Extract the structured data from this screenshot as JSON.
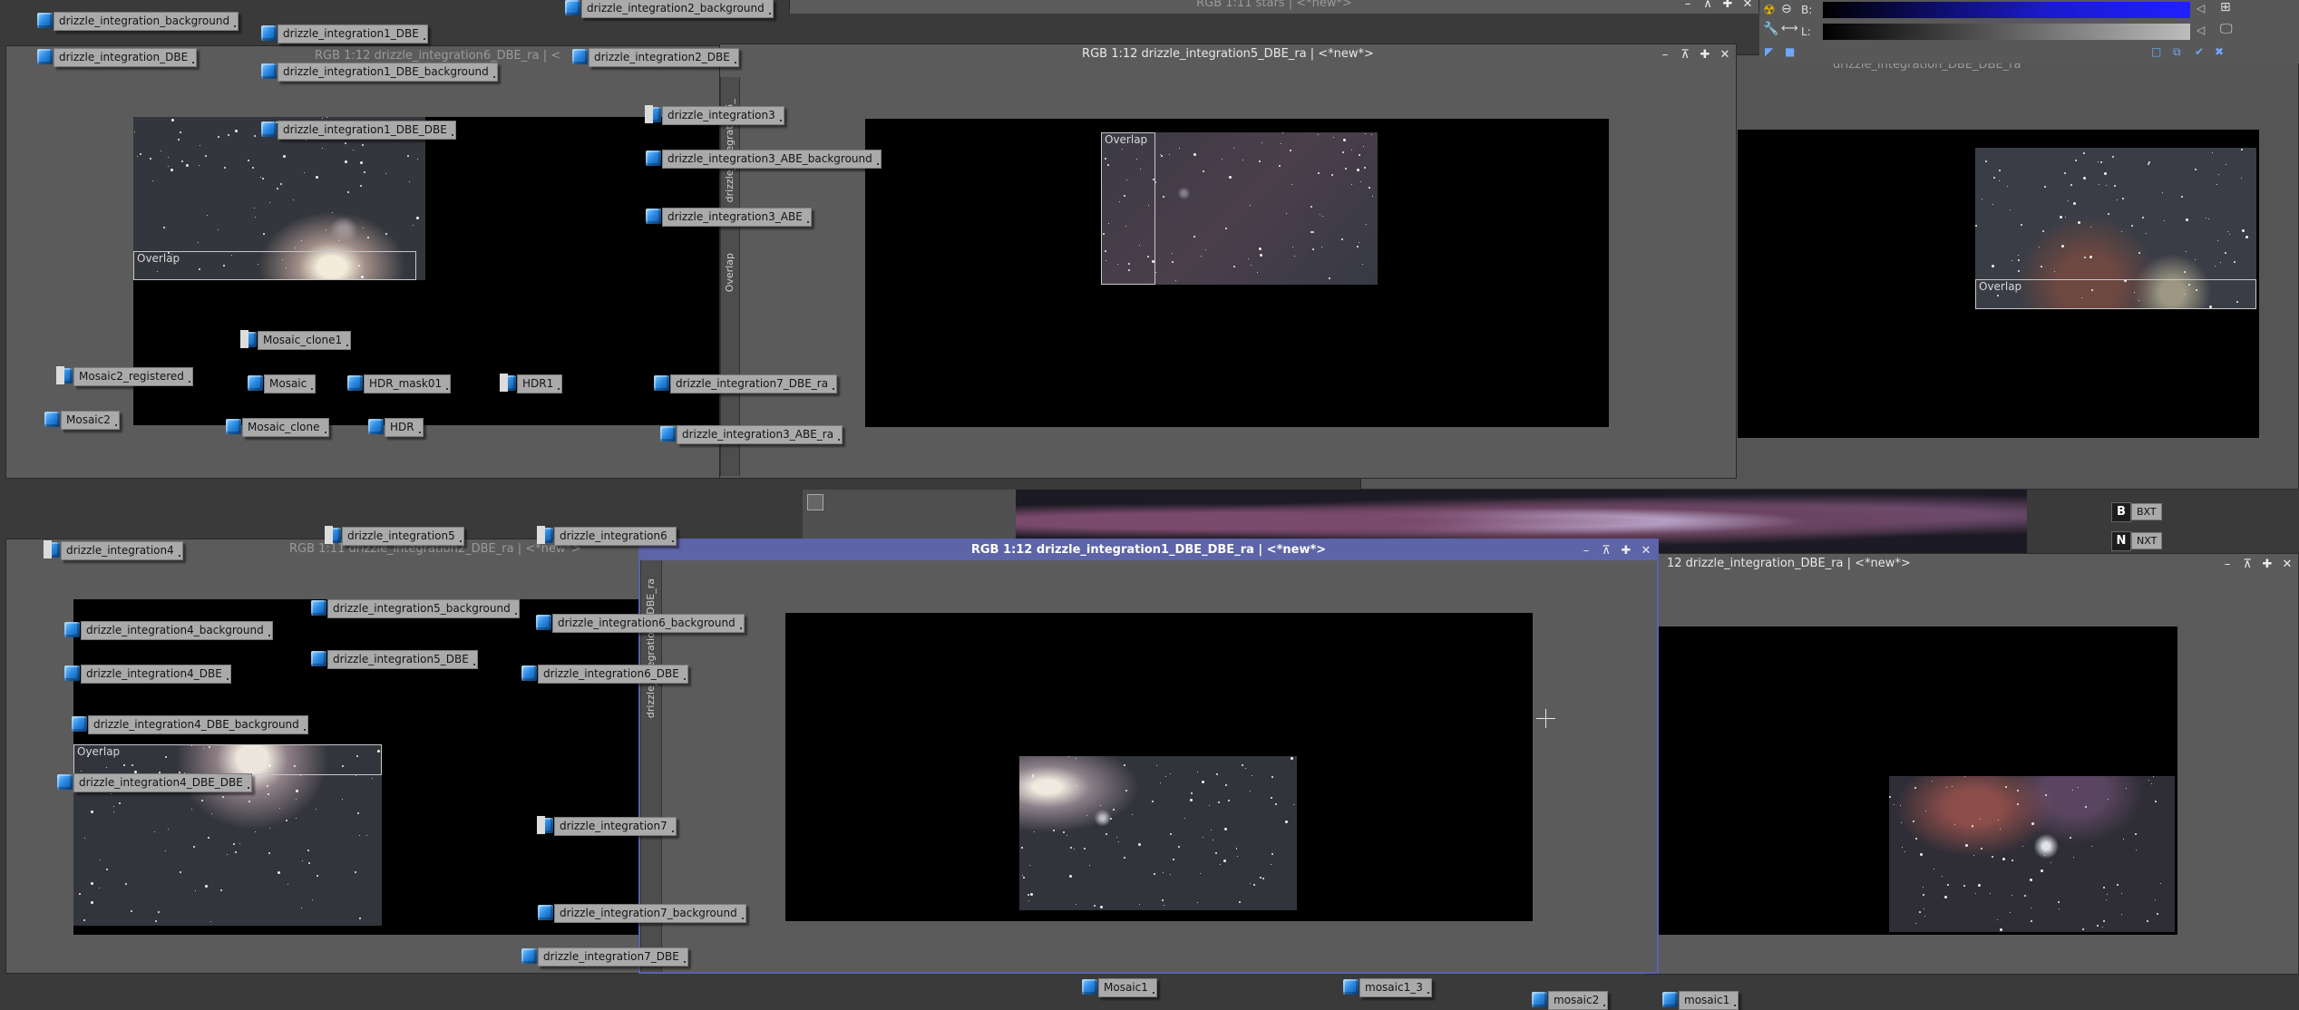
{
  "windows": {
    "w_stars": {
      "title": "RGB 1:11 stars | <*new*>"
    },
    "w_int6": {
      "title": "RGB 1:12 drizzle_integration6_DBE_ra | <"
    },
    "w_int5": {
      "title": "RGB 1:12 drizzle_integration5_DBE_ra | <*new*>"
    },
    "w_right_top": {
      "title": "drizzle_integration_DBE_DBE_ra"
    },
    "w_int2": {
      "title": "RGB 1:11 drizzle_integration2_DBE_ra | <*new*>"
    },
    "w_int1": {
      "title": "RGB 1:12 drizzle_integration1_DBE_DBE_ra | <*new*>"
    },
    "w_right_bottom": {
      "title": "12 drizzle_integration_DBE_ra | <*new*>"
    }
  },
  "overlap_label": "Overlap",
  "histogram": {
    "b_label": "B:",
    "l_label": "L:"
  },
  "icons": [
    {
      "id": "i1",
      "label": "drizzle_integration_background",
      "type": "cube"
    },
    {
      "id": "i2",
      "label": "drizzle_integration_DBE",
      "type": "cube"
    },
    {
      "id": "i3",
      "label": "drizzle_integration1_DBE",
      "type": "cube"
    },
    {
      "id": "i4",
      "label": "drizzle_integration1_DBE_background",
      "type": "cube"
    },
    {
      "id": "i5",
      "label": "drizzle_integration2_background",
      "type": "cube"
    },
    {
      "id": "i6",
      "label": "drizzle_integration2_DBE",
      "type": "cube"
    },
    {
      "id": "i7",
      "label": "drizzle_integration1_DBE_DBE",
      "type": "cube"
    },
    {
      "id": "i8",
      "label": "drizzle_integration3",
      "type": "xisf"
    },
    {
      "id": "i9",
      "label": "drizzle_integration3_ABE_background",
      "type": "cube"
    },
    {
      "id": "i10",
      "label": "drizzle_integration3_ABE",
      "type": "cube"
    },
    {
      "id": "i11",
      "label": "Mosaic_clone1",
      "type": "xisf"
    },
    {
      "id": "i12",
      "label": "Mosaic2_registered",
      "type": "xisf"
    },
    {
      "id": "i13",
      "label": "Mosaic",
      "type": "cube"
    },
    {
      "id": "i14",
      "label": "HDR_mask01",
      "type": "cube"
    },
    {
      "id": "i15",
      "label": "HDR1",
      "type": "xisf"
    },
    {
      "id": "i16",
      "label": "drizzle_integration7_DBE_ra",
      "type": "cube"
    },
    {
      "id": "i17",
      "label": "Mosaic2",
      "type": "cube"
    },
    {
      "id": "i18",
      "label": "Mosaic_clone",
      "type": "cube"
    },
    {
      "id": "i19",
      "label": "HDR",
      "type": "cube"
    },
    {
      "id": "i20",
      "label": "drizzle_integration3_ABE_ra",
      "type": "cube"
    },
    {
      "id": "i21",
      "label": "drizzle_integration5",
      "type": "xisf"
    },
    {
      "id": "i22",
      "label": "drizzle_integration6",
      "type": "xisf"
    },
    {
      "id": "i23",
      "label": "drizzle_integration4",
      "type": "xisf"
    },
    {
      "id": "i24",
      "label": "drizzle_integration5_background",
      "type": "cube"
    },
    {
      "id": "i25",
      "label": "drizzle_integration4_background",
      "type": "cube"
    },
    {
      "id": "i26",
      "label": "drizzle_integration6_background",
      "type": "cube"
    },
    {
      "id": "i27",
      "label": "drizzle_integration5_DBE",
      "type": "cube"
    },
    {
      "id": "i28",
      "label": "drizzle_integration4_DBE",
      "type": "cube"
    },
    {
      "id": "i29",
      "label": "drizzle_integration6_DBE",
      "type": "cube"
    },
    {
      "id": "i30",
      "label": "drizzle_integration4_DBE_background",
      "type": "cube"
    },
    {
      "id": "i31",
      "label": "drizzle_integration4_DBE_DBE",
      "type": "cube"
    },
    {
      "id": "i32",
      "label": "drizzle_integration7",
      "type": "xisf"
    },
    {
      "id": "i33",
      "label": "drizzle_integration7_background",
      "type": "cube"
    },
    {
      "id": "i34",
      "label": "drizzle_integration7_DBE",
      "type": "cube"
    },
    {
      "id": "i35",
      "label": "Mosaic1",
      "type": "cube"
    },
    {
      "id": "i36",
      "label": "mosaic1_3",
      "type": "cube"
    },
    {
      "id": "i37",
      "label": "mosaic2",
      "type": "cube"
    },
    {
      "id": "i38",
      "label": "mosaic1",
      "type": "cube"
    }
  ],
  "strip_labels": {
    "s1": "Overlap",
    "s2": "drizzle_integration5_",
    "s3": "drizzle_integration6_DBE_ra"
  },
  "process_icons": [
    {
      "key": "B",
      "label": "BXT"
    },
    {
      "key": "N",
      "label": "NXT"
    }
  ]
}
